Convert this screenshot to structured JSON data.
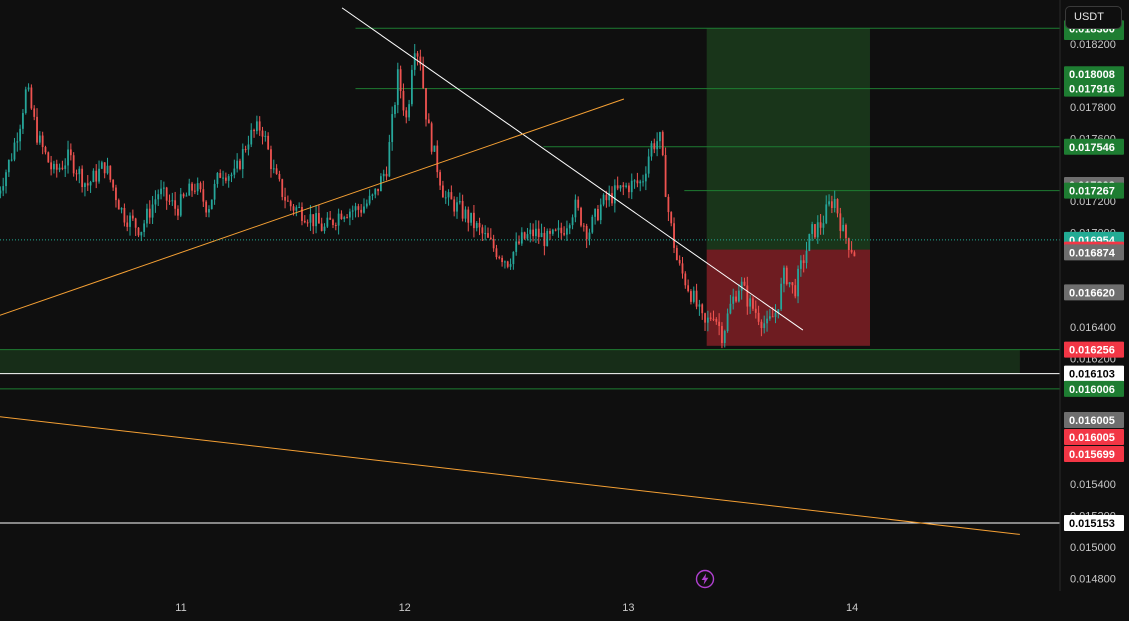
{
  "currency": "USDT",
  "chart_data": {
    "type": "candlestick",
    "title": "",
    "xlabel": "",
    "ylabel": "",
    "ylim": [
      0.01472,
      0.01848
    ],
    "x_ticks": [
      {
        "label": "11",
        "day": 11
      },
      {
        "label": "12",
        "day": 12
      },
      {
        "label": "13",
        "day": 13
      },
      {
        "label": "14",
        "day": 14
      }
    ],
    "y_ticks": [
      {
        "value": 0.0182,
        "label": "0.018200"
      },
      {
        "value": 0.0178,
        "label": "0.017800"
      },
      {
        "value": 0.0176,
        "label": "0.017600"
      },
      {
        "value": 0.0172,
        "label": "0.017200"
      },
      {
        "value": 0.017,
        "label": "0.017000"
      },
      {
        "value": 0.0164,
        "label": "0.016400"
      },
      {
        "value": 0.0162,
        "label": "0.016200"
      },
      {
        "value": 0.0156,
        "label": "0.015600"
      },
      {
        "value": 0.0154,
        "label": "0.015400"
      },
      {
        "value": 0.0152,
        "label": "0.015200"
      },
      {
        "value": 0.015,
        "label": "0.015000"
      },
      {
        "value": 0.0148,
        "label": "0.014800"
      }
    ],
    "price_badges": [
      {
        "label": "0.018919",
        "value": 0.01832,
        "color": "#1e7d32"
      },
      {
        "label": "0.018300",
        "value": 0.0183,
        "color": "#1e7d32"
      },
      {
        "label": "0.018008",
        "value": 0.018008,
        "color": "#1e7d32"
      },
      {
        "label": "0.017916",
        "value": 0.017916,
        "color": "#1e7d32"
      },
      {
        "label": "0.017546",
        "value": 0.017546,
        "color": "#1e7d32"
      },
      {
        "label": "0.017303",
        "value": 0.017303,
        "color": "#6e6e6e"
      },
      {
        "label": "0.017267",
        "value": 0.017267,
        "color": "#1e7d32"
      },
      {
        "label": "0.016954",
        "value": 0.016954,
        "color": "#22ab94"
      },
      {
        "label": "0.016892",
        "value": 0.016892,
        "color": "#f23645"
      },
      {
        "label": "0.016874",
        "value": 0.016874,
        "color": "#6e6e6e"
      },
      {
        "label": "0.016620",
        "value": 0.01662,
        "color": "#6e6e6e"
      },
      {
        "label": "0.016256",
        "value": 0.016256,
        "color": "#f23645"
      },
      {
        "label": "0.016103",
        "value": 0.016103,
        "color": "#ffffff",
        "text_color": "#000000"
      },
      {
        "label": "0.016006",
        "value": 0.016006,
        "color": "#1e7d32"
      },
      {
        "label": "0.016005",
        "value": 0.016005,
        "color": "#6e6e6e"
      },
      {
        "label": "0.016005",
        "value": 0.016005,
        "color": "#f23645"
      },
      {
        "label": "0.015699",
        "value": 0.015699,
        "color": "#f23645"
      },
      {
        "label": "0.015153",
        "value": 0.015153,
        "color": "#ffffff",
        "text_color": "#000000"
      }
    ],
    "price_path": [
      [
        10.18,
        0.01725
      ],
      [
        10.24,
        0.01748
      ],
      [
        10.28,
        0.0177
      ],
      [
        10.31,
        0.01792
      ],
      [
        10.36,
        0.0176
      ],
      [
        10.43,
        0.01738
      ],
      [
        10.5,
        0.01748
      ],
      [
        10.58,
        0.0173
      ],
      [
        10.66,
        0.01743
      ],
      [
        10.74,
        0.01712
      ],
      [
        10.82,
        0.01702
      ],
      [
        10.9,
        0.01726
      ],
      [
        10.98,
        0.01715
      ],
      [
        11.06,
        0.0173
      ],
      [
        11.12,
        0.01716
      ],
      [
        11.18,
        0.0174
      ],
      [
        11.24,
        0.01736
      ],
      [
        11.3,
        0.0176
      ],
      [
        11.36,
        0.01768
      ],
      [
        11.42,
        0.01735
      ],
      [
        11.48,
        0.01718
      ],
      [
        11.56,
        0.01712
      ],
      [
        11.64,
        0.01702
      ],
      [
        11.72,
        0.01714
      ],
      [
        11.8,
        0.01715
      ],
      [
        11.86,
        0.01722
      ],
      [
        11.92,
        0.01742
      ],
      [
        11.97,
        0.018
      ],
      [
        12.01,
        0.0177
      ],
      [
        12.04,
        0.01822
      ],
      [
        12.07,
        0.0181
      ],
      [
        12.1,
        0.0177
      ],
      [
        12.14,
        0.01745
      ],
      [
        12.18,
        0.01722
      ],
      [
        12.22,
        0.01718
      ],
      [
        12.28,
        0.0171
      ],
      [
        12.34,
        0.017
      ],
      [
        12.4,
        0.0169
      ],
      [
        12.46,
        0.01682
      ],
      [
        12.52,
        0.01695
      ],
      [
        12.58,
        0.017
      ],
      [
        12.64,
        0.01695
      ],
      [
        12.7,
        0.017
      ],
      [
        12.76,
        0.01717
      ],
      [
        12.82,
        0.017
      ],
      [
        12.88,
        0.01718
      ],
      [
        12.94,
        0.01725
      ],
      [
        13.0,
        0.0173
      ],
      [
        13.06,
        0.01732
      ],
      [
        13.1,
        0.01755
      ],
      [
        13.14,
        0.0176
      ],
      [
        13.18,
        0.01712
      ],
      [
        13.22,
        0.0168
      ],
      [
        13.26,
        0.01668
      ],
      [
        13.3,
        0.01655
      ],
      [
        13.34,
        0.0164
      ],
      [
        13.38,
        0.0165
      ],
      [
        13.42,
        0.01635
      ],
      [
        13.46,
        0.01655
      ],
      [
        13.5,
        0.01668
      ],
      [
        13.54,
        0.01655
      ],
      [
        13.58,
        0.01648
      ],
      [
        13.62,
        0.0164
      ],
      [
        13.66,
        0.0165
      ],
      [
        13.7,
        0.01675
      ],
      [
        13.74,
        0.01662
      ],
      [
        13.78,
        0.01682
      ],
      [
        13.82,
        0.017
      ],
      [
        13.86,
        0.01705
      ],
      [
        13.9,
        0.01718
      ],
      [
        13.92,
        0.01722
      ],
      [
        13.96,
        0.017
      ],
      [
        14.0,
        0.0169
      ],
      [
        14.02,
        0.01685
      ]
    ],
    "trendlines": [
      {
        "color": "#ffffff",
        "points": [
          [
            11.72,
            0.01843
          ],
          [
            13.78,
            0.01638
          ]
        ]
      },
      {
        "color": "#f5a034",
        "points": [
          [
            10.0,
            0.01638
          ],
          [
            12.98,
            0.01785
          ]
        ]
      },
      {
        "color": "#f5a034",
        "points": [
          [
            10.0,
            0.01586
          ],
          [
            14.75,
            0.01508
          ]
        ]
      }
    ],
    "horizontal_lines": [
      {
        "value": 0.0183,
        "from": 11.78,
        "color": "#1e7d32"
      },
      {
        "value": 0.017916,
        "from": 11.78,
        "color": "#1e7d32"
      },
      {
        "value": 0.017546,
        "from": 12.62,
        "color": "#1e7d32"
      },
      {
        "value": 0.017267,
        "from": 13.25,
        "color": "#1e7d32"
      },
      {
        "value": 0.016256,
        "from": 10.0,
        "color": "#1e7d32"
      },
      {
        "value": 0.016103,
        "from": 10.0,
        "color": "#ffffff"
      },
      {
        "value": 0.016006,
        "from": 10.0,
        "color": "#1e7d32"
      },
      {
        "value": 0.015153,
        "from": 10.0,
        "color": "#ffffff"
      }
    ],
    "zones": [
      {
        "type": "long-profit",
        "x_from": 13.35,
        "x_to": 14.08,
        "y_from": 0.016892,
        "y_to": 0.0183,
        "color": "rgba(46,125,50,0.35)"
      },
      {
        "type": "long-risk",
        "x_from": 13.35,
        "x_to": 14.08,
        "y_from": 0.01628,
        "y_to": 0.016892,
        "color": "rgba(190,40,50,0.55)"
      },
      {
        "type": "support-zone",
        "x_from": 10.0,
        "x_to": 14.75,
        "y_from": 0.016103,
        "y_to": 0.016256,
        "color": "rgba(46,125,50,0.28)"
      },
      {
        "type": "left-profit",
        "x_from": 10.0,
        "x_to": 10.1,
        "y_from": 0.016954,
        "y_to": 0.0185,
        "color": "rgba(46,125,50,0.35)"
      },
      {
        "type": "left-risk",
        "x_from": 10.0,
        "x_to": 10.1,
        "y_from": 0.01565,
        "y_to": 0.01662,
        "color": "rgba(190,40,50,0.55)"
      }
    ],
    "current_price": 0.016954,
    "grid": false,
    "legend": "none"
  }
}
